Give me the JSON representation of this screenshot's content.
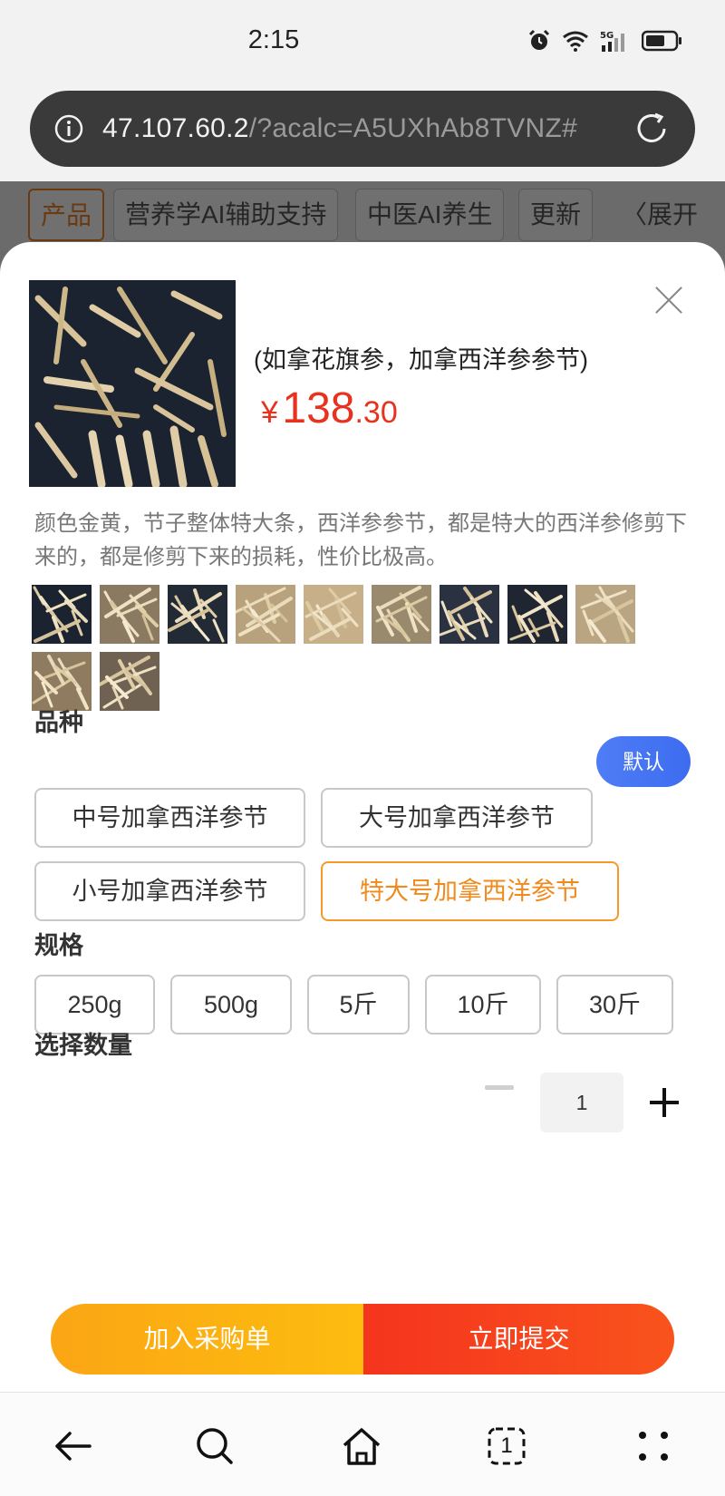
{
  "status_bar": {
    "time": "2:15",
    "network": "5G"
  },
  "browser": {
    "url_host": "47.107.60.2",
    "url_path": "/?acalc=A5UXhAb8TVNZ#",
    "tab_count": "1"
  },
  "site_nav": {
    "tabs": [
      "产品",
      "营养学AI辅助支持",
      "中医AI养生",
      "更新"
    ],
    "expand_label": "展开"
  },
  "product": {
    "title": "(如拿花旗参，加拿西洋参参节)",
    "price_symbol": "¥",
    "price_integer": "138",
    "price_decimal": ".30",
    "description": "颜色金黄，节子整体特大条，西洋参参节，都是特大的西洋参修剪下来的，都是修剪下来的损耗，性价比极高。",
    "thumbnail_count": 11
  },
  "variety": {
    "label": "品种",
    "default_badge": "默认",
    "options": [
      "中号加拿西洋参节",
      "大号加拿西洋参节",
      "小号加拿西洋参节",
      "特大号加拿西洋参节"
    ],
    "selected": "特大号加拿西洋参节"
  },
  "spec": {
    "label": "规格",
    "options": [
      "250g",
      "500g",
      "5斤",
      "10斤",
      "30斤"
    ]
  },
  "quantity": {
    "label": "选择数量",
    "value": "1"
  },
  "actions": {
    "add_to_cart": "加入采购单",
    "submit": "立即提交"
  },
  "colors": {
    "accent_orange": "#f08a1c",
    "price_red": "#e8321e",
    "submit_red": "#f5341e",
    "badge_blue": "#4f7df6"
  }
}
